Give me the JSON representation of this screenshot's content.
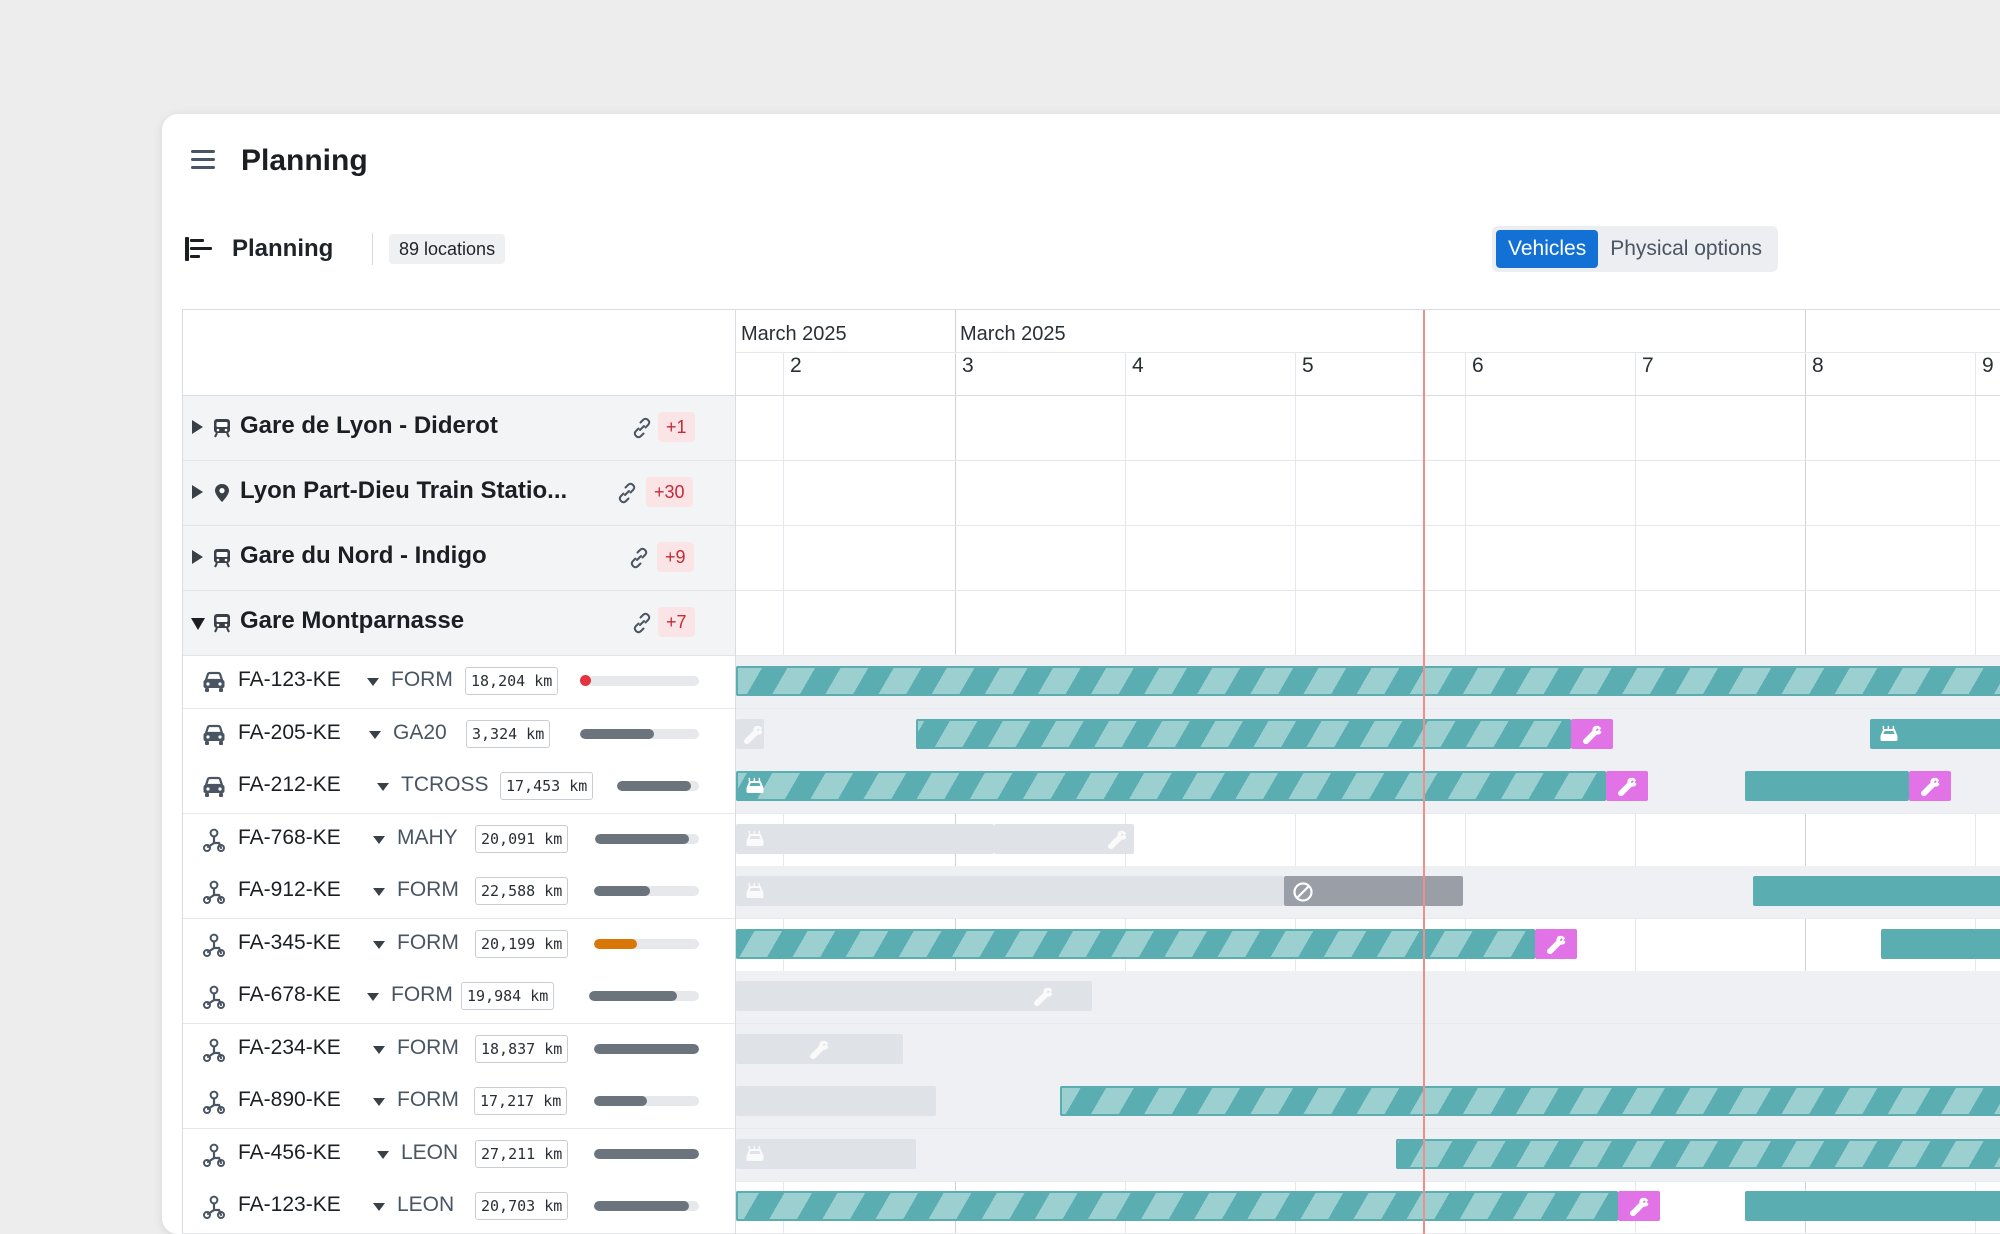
{
  "app": {
    "title": "Planning"
  },
  "toolbar": {
    "planning_label": "Planning",
    "locations_badge": "89 locations",
    "toggle": [
      {
        "label": "Vehicles",
        "active": true
      },
      {
        "label": "Physical options",
        "active": false
      }
    ]
  },
  "timeline": {
    "months": [
      "March 2025",
      "March 2025"
    ],
    "days": [
      "2",
      "3",
      "4",
      "5",
      "6",
      "7",
      "8",
      "9"
    ]
  },
  "groups": [
    {
      "name": "Gare de Lyon - Diderot",
      "icon": "train-icon",
      "badge": "+1",
      "expanded": false
    },
    {
      "name": "Lyon Part-Dieu Train Statio...",
      "icon": "location-pin-icon",
      "badge": "+30",
      "expanded": false
    },
    {
      "name": "Gare du Nord - Indigo",
      "icon": "train-icon",
      "badge": "+9",
      "expanded": false
    },
    {
      "name": "Gare Montparnasse",
      "icon": "train-icon",
      "badge": "+7",
      "expanded": true
    }
  ],
  "vehicles": [
    {
      "plate": "FA-123-KE",
      "model": "FORM",
      "km": "18,204 km",
      "type": "car-icon",
      "level": 0.0,
      "alert": true
    },
    {
      "plate": "FA-205-KE",
      "model": "GA20",
      "km": "3,324 km",
      "type": "car-icon",
      "level": 0.62
    },
    {
      "plate": "FA-212-KE",
      "model": "TCROSS",
      "km": "17,453 km",
      "type": "car-icon",
      "level": 0.9
    },
    {
      "plate": "FA-768-KE",
      "model": "MAHY",
      "km": "20,091 km",
      "type": "scooter-icon",
      "level": 0.9
    },
    {
      "plate": "FA-912-KE",
      "model": "FORM",
      "km": "22,588 km",
      "type": "scooter-icon",
      "level": 0.53
    },
    {
      "plate": "FA-345-KE",
      "model": "FORM",
      "km": "20,199 km",
      "type": "scooter-icon",
      "level": 0.41,
      "warning": true
    },
    {
      "plate": "FA-678-KE",
      "model": "FORM",
      "km": "19,984 km",
      "type": "scooter-icon",
      "level": 0.8
    },
    {
      "plate": "FA-234-KE",
      "model": "FORM",
      "km": "18,837 km",
      "type": "scooter-icon",
      "level": 1.0
    },
    {
      "plate": "FA-890-KE",
      "model": "FORM",
      "km": "17,217 km",
      "type": "scooter-icon",
      "level": 0.5
    },
    {
      "plate": "FA-456-KE",
      "model": "LEON",
      "km": "27,211 km",
      "type": "scooter-icon",
      "level": 1.0
    },
    {
      "plate": "FA-123-KE",
      "model": "LEON",
      "km": "20,703 km",
      "type": "scooter-icon",
      "level": 0.9
    }
  ],
  "colors": {
    "accent": "#1371d6",
    "teal": "#5aadb0",
    "maintenance": "#e173e6",
    "today_line": "#f08d8d",
    "alert": "#e5323f",
    "warning": "#d97706"
  }
}
